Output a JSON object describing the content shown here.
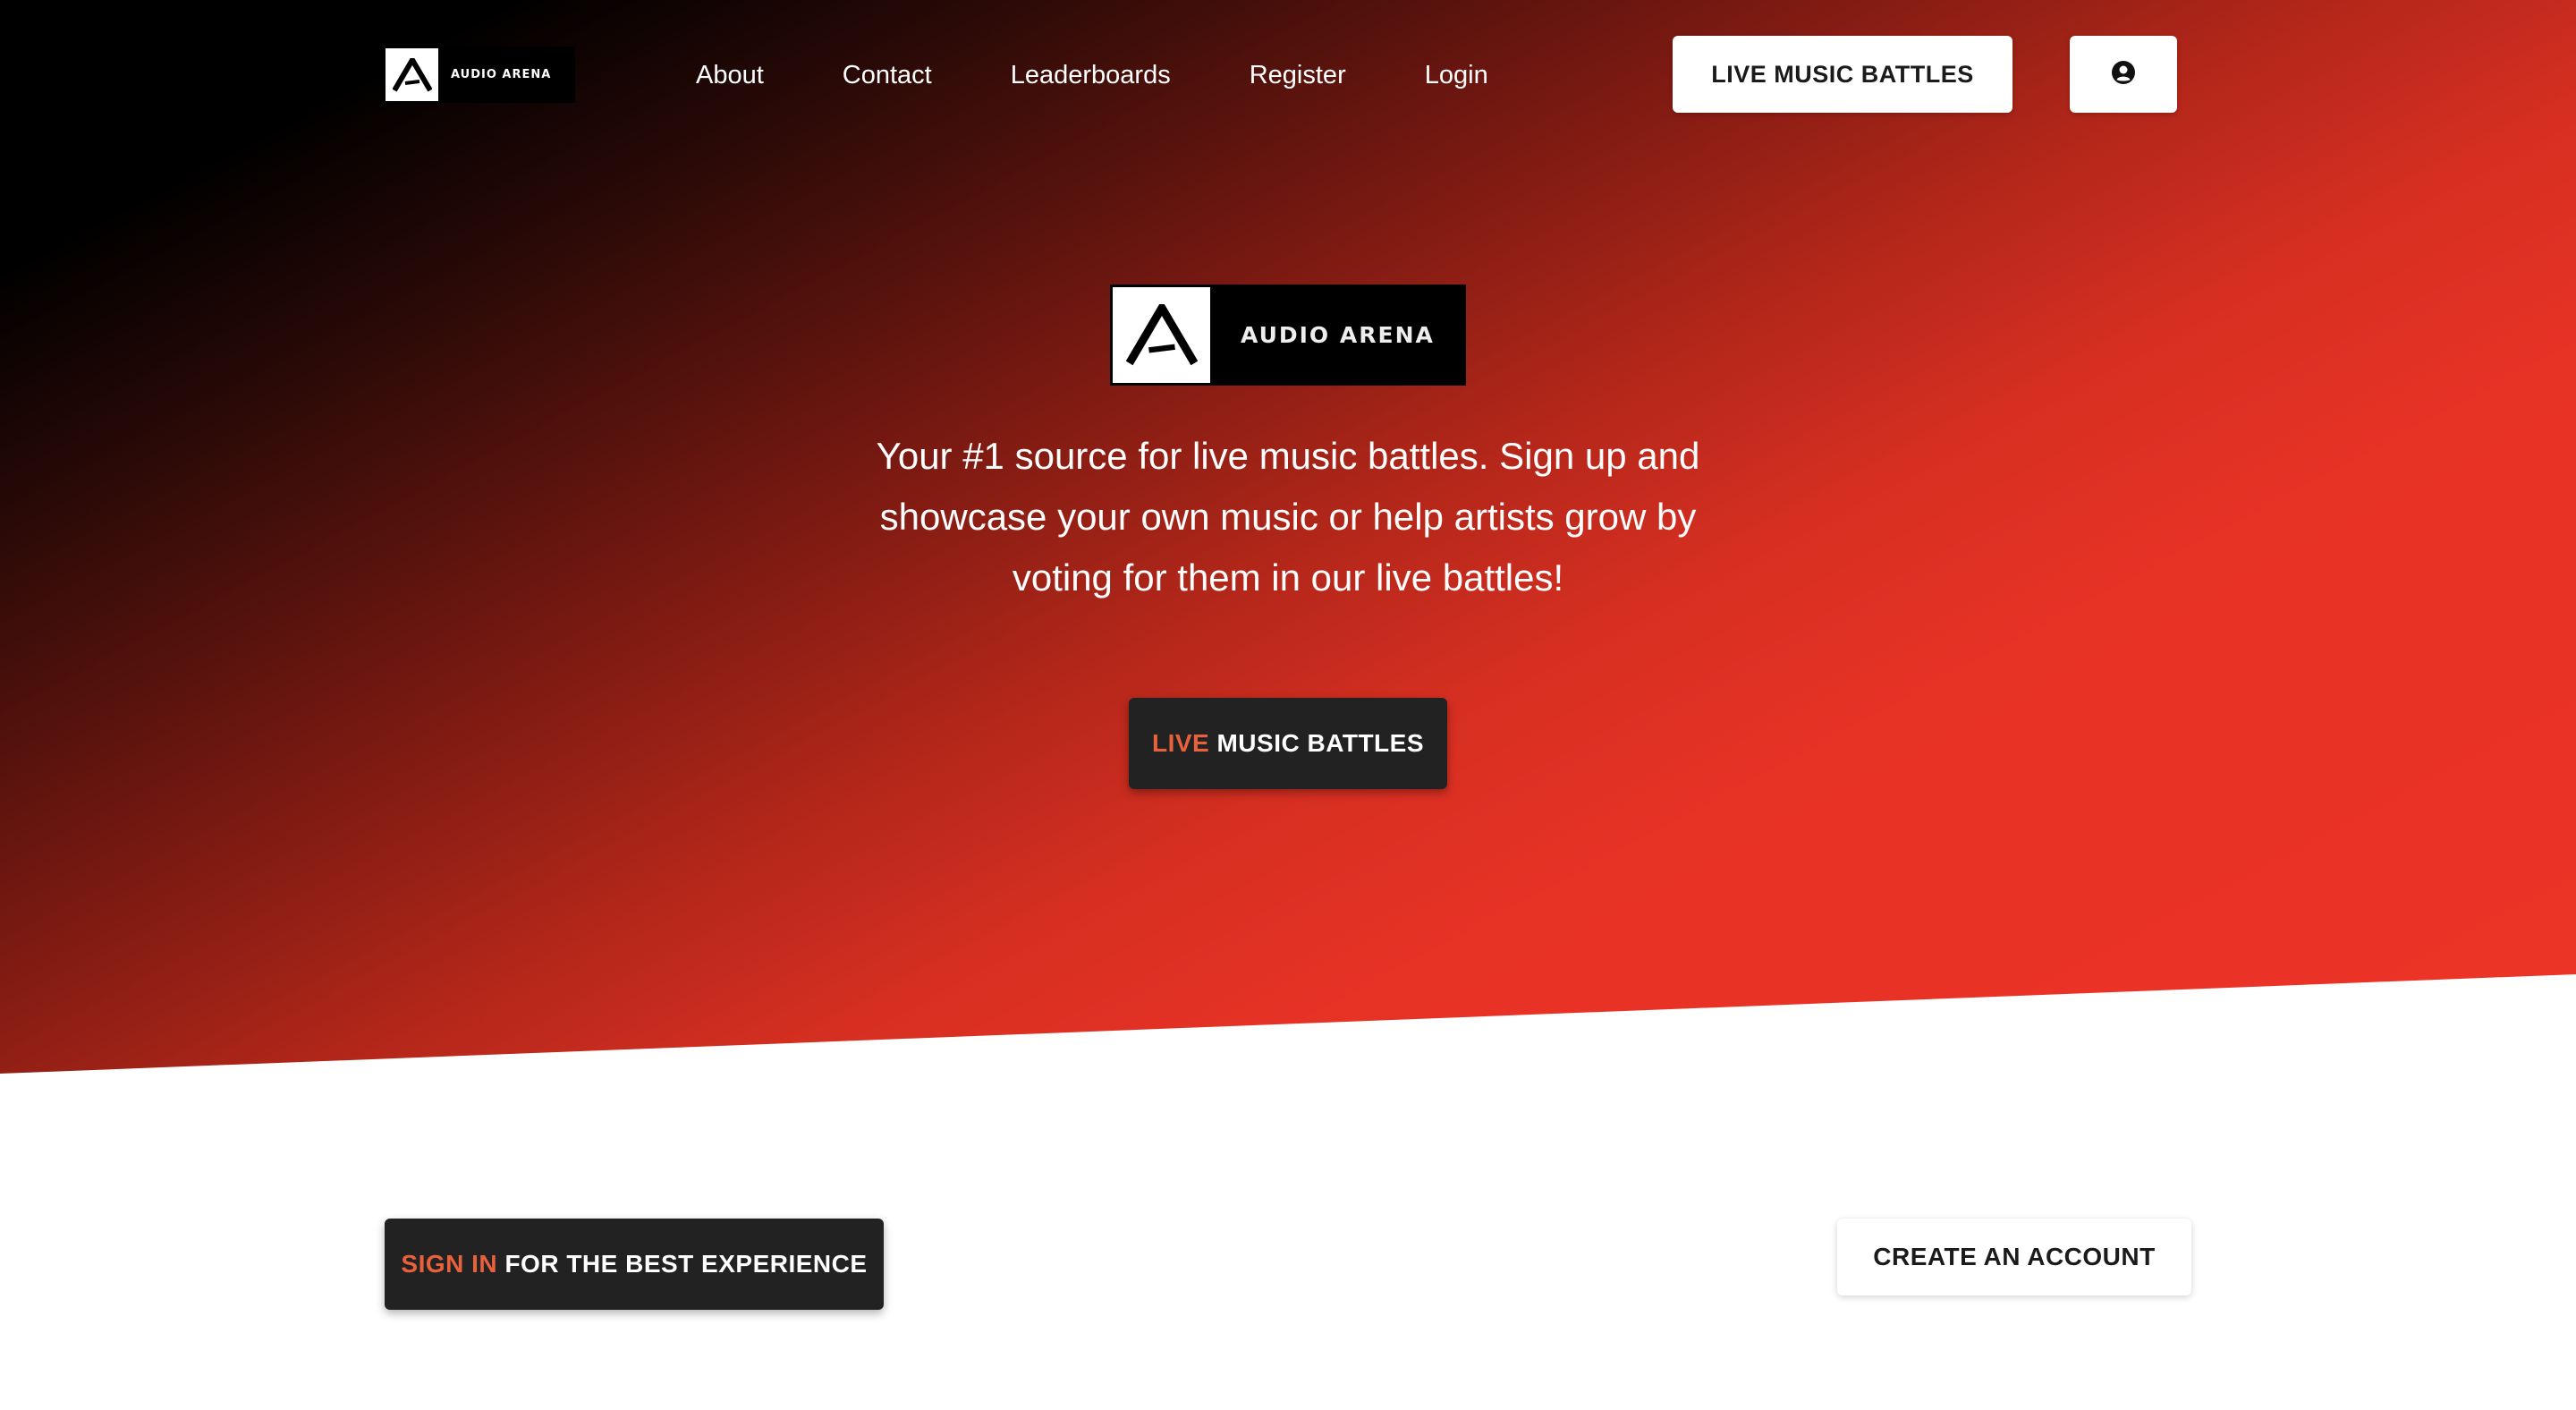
{
  "header": {
    "logo": {
      "wordmark": "AUDIO ARENA",
      "icon": "audio-arena-logo-icon"
    },
    "nav": [
      {
        "label": "About"
      },
      {
        "label": "Contact"
      },
      {
        "label": "Leaderboards"
      },
      {
        "label": "Register"
      },
      {
        "label": "Login"
      }
    ],
    "live_button_label": "LIVE MUSIC BATTLES",
    "user_button_icon": "user-circle-icon"
  },
  "hero": {
    "logo": {
      "wordmark": "AUDIO ARENA",
      "icon": "audio-arena-logo-icon"
    },
    "tagline": "Your #1 source for live music battles. Sign up and showcase your own music or help artists grow by voting for them in our live battles!",
    "button": {
      "accent_text": "LIVE",
      "rest_text": "MUSIC BATTLES"
    }
  },
  "cta": {
    "signin": {
      "accent_text": "SIGN IN",
      "rest_text": "FOR THE BEST EXPERIENCE"
    },
    "create_account_label": "CREATE AN ACCOUNT"
  },
  "colors": {
    "accent": "#e8603c",
    "gradient_start": "#000000",
    "gradient_end": "#ec3326",
    "dark_button": "#222222"
  }
}
